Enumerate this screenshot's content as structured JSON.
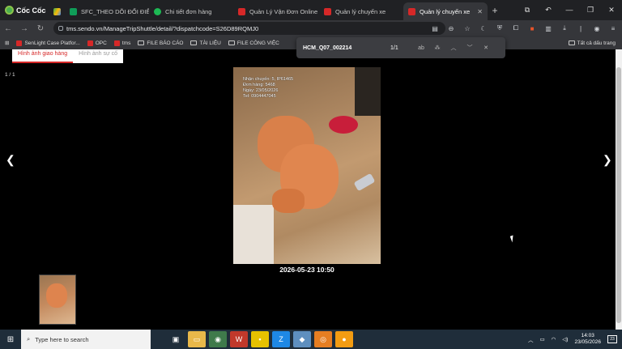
{
  "browser": {
    "name": "Cốc Cốc",
    "tabs": [
      {
        "label": "",
        "icon": "drive-icon"
      },
      {
        "label": "SFC_THEO DÕI ĐỔI ĐIỂM",
        "icon": "sheets-icon"
      },
      {
        "label": "Chi tiết đơn hàng",
        "icon": "app-icon"
      },
      {
        "label": "Quản Lý Vận Đơn Online",
        "icon": "sendo-icon"
      },
      {
        "label": "Quản lý chuyến xe",
        "icon": "sendo-icon"
      },
      {
        "label": "Quản lý chuyến xe",
        "icon": "sendo-icon",
        "active": true
      }
    ],
    "url": "tms.sendo.vn/ManageTripShuttle/detail/?dispatchcode=S26D89RQMJ0",
    "bookmarks": [
      {
        "label": "SenLight Case Platfor...",
        "icon": "sendo-icon"
      },
      {
        "label": "OPC",
        "icon": "sendo-icon"
      },
      {
        "label": "tms",
        "icon": "sendo-icon"
      },
      {
        "label": "FILE BÁO CÁO",
        "icon": "folder-icon"
      },
      {
        "label": "TÀI LIỆU",
        "icon": "folder-icon"
      },
      {
        "label": "FILE CÔNG VIỆC",
        "icon": "folder-icon"
      }
    ],
    "all_bookmarks": "Tất cả dấu trang"
  },
  "find": {
    "query": "HCM_Q07_002214",
    "count": "1/1"
  },
  "viewer": {
    "tabs": [
      "Hình ảnh giao hàng",
      "Hình ảnh sự cố"
    ],
    "counter": "1 / 1",
    "photo_stamp": [
      "Nhận chuyến: 5, IP61465",
      "Đơn hàng: 5468",
      "Ngày: 23/05/2026",
      "Tel: 0904447045"
    ],
    "caption": "2026-05-23 10:50"
  },
  "taskbar": {
    "search_placeholder": "Type here to search",
    "time": "14:03",
    "date": "23/05/2026",
    "notifications": "23"
  }
}
